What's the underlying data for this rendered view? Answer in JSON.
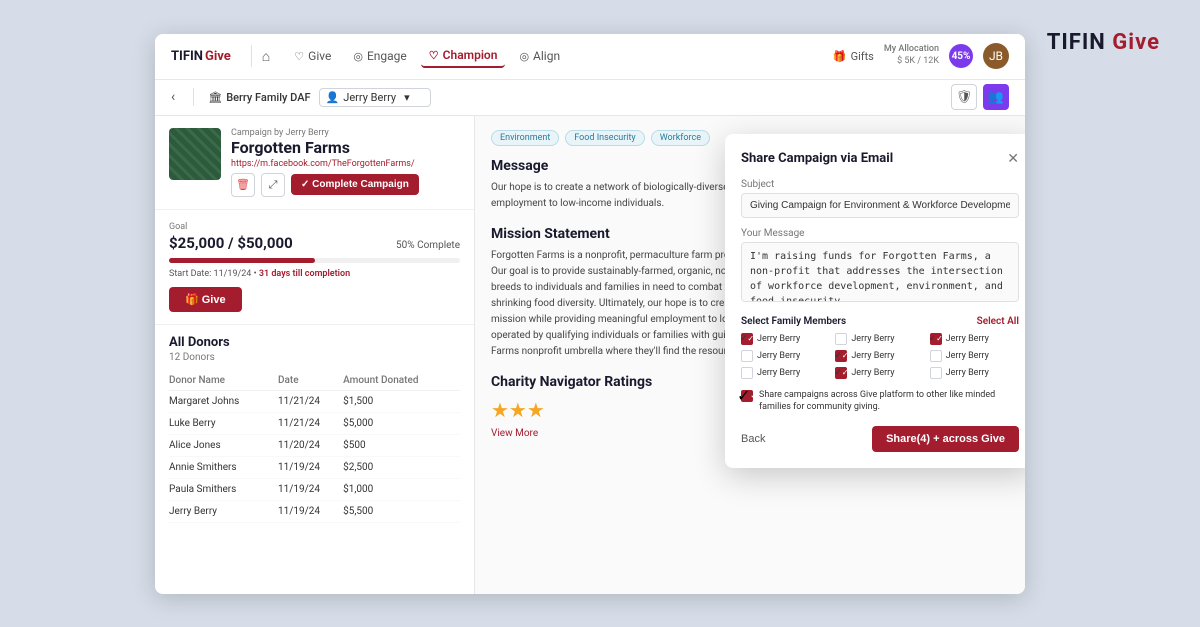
{
  "brand": {
    "tifin": "TIFIN",
    "give": "Give"
  },
  "topNav": {
    "home_icon": "⌂",
    "links": [
      {
        "id": "give",
        "label": "Give",
        "icon": "♡",
        "active": false
      },
      {
        "id": "engage",
        "label": "Engage",
        "icon": "◎",
        "active": false
      },
      {
        "id": "champion",
        "label": "Champion",
        "icon": "♡",
        "active": true
      },
      {
        "id": "align",
        "label": "Align",
        "icon": "◎",
        "active": false
      }
    ],
    "gifts": "Gifts",
    "allocation_label": "My Allocation",
    "allocation_value": "$ 5K / 12K",
    "allocation_pct": "45%",
    "avatar_initials": "JB"
  },
  "subNav": {
    "daf_icon": "🏛",
    "daf_name": "Berry Family DAF",
    "user_icon": "👤",
    "user_name": "Jerry Berry"
  },
  "campaign": {
    "by_label": "Campaign by Jerry Berry",
    "title": "Forgotten Farms",
    "url": "https://m.facebook.com/TheForgottenFarms/",
    "complete_btn": "✓ Complete Campaign"
  },
  "goal": {
    "label": "Goal",
    "amount": "$25,000 / $50,000",
    "pct": "50% Complete",
    "progress": 50,
    "start_date": "Start Date: 11/19/24 •",
    "days_left": "31 days till completion",
    "give_btn": "🎁 Give"
  },
  "donors": {
    "title": "All Donors",
    "count": "12 Donors",
    "columns": [
      "Donor Name",
      "Date",
      "Amount Donated"
    ],
    "rows": [
      {
        "name": "Margaret Johns",
        "date": "11/21/24",
        "amount": "$1,500"
      },
      {
        "name": "Luke Berry",
        "date": "11/21/24",
        "amount": "$5,000"
      },
      {
        "name": "Alice Jones",
        "date": "11/20/24",
        "amount": "$500"
      },
      {
        "name": "Annie Smithers",
        "date": "11/19/24",
        "amount": "$2,500"
      },
      {
        "name": "Paula Smithers",
        "date": "11/19/24",
        "amount": "$1,000"
      },
      {
        "name": "Jerry Berry",
        "date": "11/19/24",
        "amount": "$5,500"
      }
    ]
  },
  "rightPanel": {
    "tags": [
      "Environment",
      "Food Insecurity",
      "Workforce"
    ],
    "message_title": "Message",
    "message_text": "Our hope is to create a network of biologically-diverse farms serving the same mission while providing meaningful employment to low-income individuals.",
    "mission_title": "Mission Statement",
    "mission_text": "Forgotten Farms is a nonprofit, permaculture farm providing organically-grown produce and pastured meat and eggs. Our goal is to provide sustainably-farmed, organic, non-GMO, heirloom produce and meat and eggs from heritage breeds to individuals and families in need to combat food insecurity in our community and raise awareness to shrinking food diversity. Ultimately, our hope is to create a network of biologically-diverse farms serving the same mission while providing meaningful employment to low-income individuals. Each farm within our network will be operated by qualifying individuals or families with guidance from Forgotten Farms and falling under the Forgotten Farms nonprofit umbrella where they'll find the resources needed to become self-supporting entities.",
    "charity_title": "Charity Navigator Ratings",
    "stars": "★★★",
    "view_more": "View More"
  },
  "emailModal": {
    "title": "Share Campaign via Email",
    "close_icon": "✕",
    "subject_label": "Subject",
    "subject_value": "Giving Campaign for Environment & Workforce Development",
    "message_label": "Your Message",
    "message_value": "I'm raising funds for Forgotten Farms, a non-profit that addresses the intersection of workforce development, environment, and food insecurity.\n\nWill you join my campaign?",
    "family_label": "Select Family Members",
    "select_all": "Select All",
    "family_members": [
      {
        "name": "Jerry Berry",
        "checked": true
      },
      {
        "name": "Jerry Berry",
        "checked": false
      },
      {
        "name": "Jerry Berry",
        "checked": true
      },
      {
        "name": "Jerry Berry",
        "checked": false
      },
      {
        "name": "Jerry Berry",
        "checked": true
      },
      {
        "name": "Jerry Berry",
        "checked": false
      },
      {
        "name": "Jerry Berry",
        "checked": false
      },
      {
        "name": "Jerry Berry",
        "checked": true
      },
      {
        "name": "Jerry Berry",
        "checked": false
      }
    ],
    "share_platform_text": "Share campaigns across Give platform to other like minded families for community giving.",
    "share_platform_checked": true,
    "back_btn": "Back",
    "share_btn": "Share(4) + across Give"
  }
}
